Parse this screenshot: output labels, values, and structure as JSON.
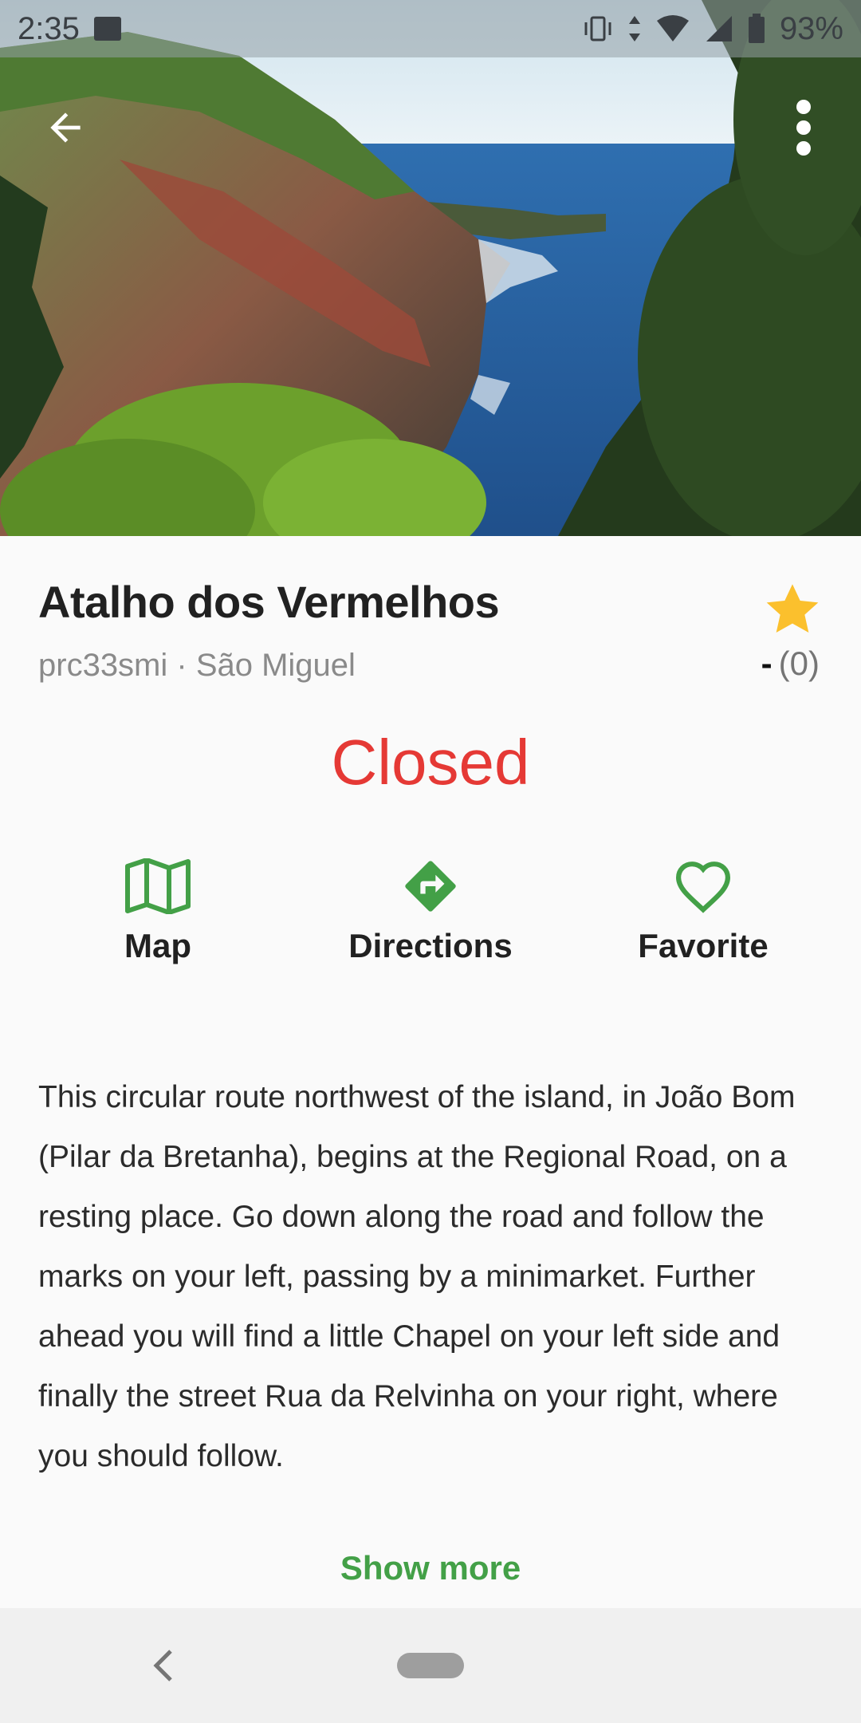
{
  "status_bar": {
    "time": "2:35",
    "battery": "93%",
    "icons": [
      "image-icon",
      "vibrate-icon",
      "data-arrows-icon",
      "wifi-icon",
      "signal-icon",
      "battery-icon"
    ]
  },
  "hero": {
    "back_icon": "arrow-back-icon",
    "more_icon": "more-vert-icon"
  },
  "place": {
    "title": "Atalho dos Vermelhos",
    "subtitle": "prc33smi · São Miguel",
    "rating_value": "-",
    "rating_count": "(0)",
    "status": "Closed"
  },
  "actions": [
    {
      "label": "Map",
      "icon": "map-icon"
    },
    {
      "label": "Directions",
      "icon": "directions-icon"
    },
    {
      "label": "Favorite",
      "icon": "heart-outline-icon"
    }
  ],
  "description": "This circular route northwest of the island, in João Bom (Pilar da Bretanha), begins at the Regional Road, on a resting place. Go down along the road and follow the marks on your left, passing by a minimarket. Further ahead you will find a little Chapel on your left side and finally the street Rua da Relvinha on your right, where you should follow.",
  "show_more": "Show more",
  "colors": {
    "accent": "#43a047",
    "closed": "#e53935",
    "star": "#fbc02d"
  }
}
